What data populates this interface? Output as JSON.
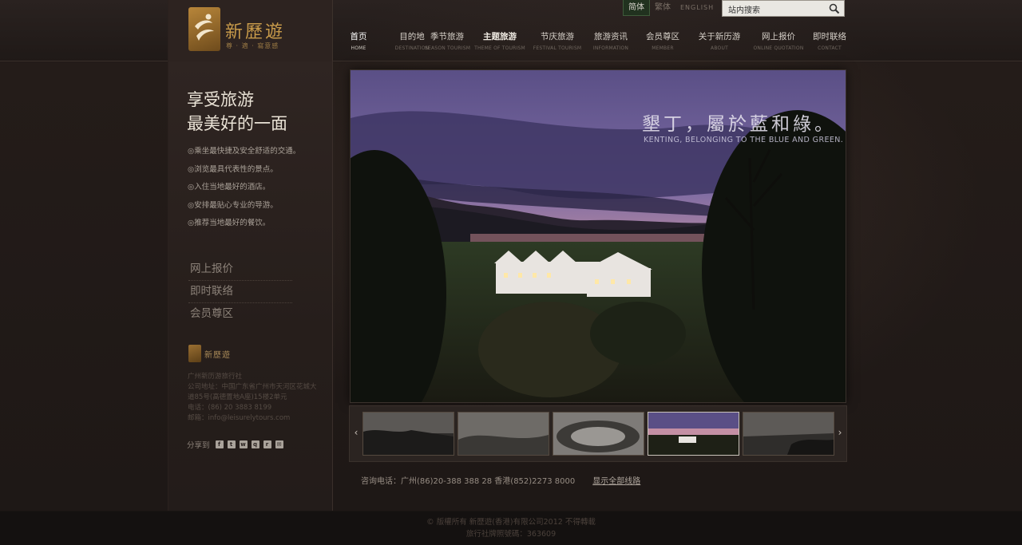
{
  "header": {
    "logo_name": "新歷遊",
    "logo_tagline": "尊 · 適 · 寫意感",
    "languages": [
      {
        "label": "简体",
        "active": true
      },
      {
        "label": "繁体",
        "active": false
      },
      {
        "label": "ENGLISH",
        "active": false
      }
    ],
    "search": {
      "placeholder": "站内搜索"
    },
    "nav": [
      {
        "cn": "首页",
        "en": "HOME"
      },
      {
        "cn": "目的地",
        "en": "DESTINATION"
      },
      {
        "cn": "季节旅游",
        "en": "SEASON TOURISM"
      },
      {
        "cn": "主题旅游",
        "en": "THEME OF TOURISM"
      },
      {
        "cn": "节庆旅游",
        "en": "FESTIVAL TOURISM"
      },
      {
        "cn": "旅游资讯",
        "en": "INFORMATION"
      },
      {
        "cn": "会员尊区",
        "en": "MEMBER"
      },
      {
        "cn": "关于新历游",
        "en": "ABOUT"
      },
      {
        "cn": "网上报价",
        "en": "ONLINE QUOTATION"
      },
      {
        "cn": "即时联络",
        "en": "CONTACT"
      }
    ]
  },
  "sidebar": {
    "slogan_line1": "享受旅游",
    "slogan_line2": "最美好的一面",
    "features": [
      "◎乘坐最快捷及安全舒适的交通。",
      "◎浏览最具代表性的景点。",
      "◎入住当地最好的酒店。",
      "◎安排最贴心专业的导游。",
      "◎推荐当地最好的餐饮。"
    ],
    "quick_links": [
      "网上报价",
      "即时联络",
      "会员尊区"
    ],
    "mini_logo": "新歷遊",
    "company": "广州新历游旅行社",
    "address": "公司地址：中国广东省广州市天河区花城大道85号(高德置地A座)15楼2单元",
    "phone": "电话：(86) 20 3883 8199",
    "email": "邮箱：info@leisurelytours.com",
    "share_label": "分享到"
  },
  "hero": {
    "title": "墾丁，屬於藍和綠。",
    "subtitle": "KENTING, BELONGING TO THE BLUE AND GREEN."
  },
  "thumbnails": {
    "count": 5,
    "active_index": 3
  },
  "footer": {
    "hotline": "咨询电话：广州(86)20-388 388 28  香港(852)2273 8000",
    "show_all": "显示全部线路",
    "copyright_line1": "© 版權所有 新歷遊(香港)有限公司2012 不得轉載",
    "copyright_line2": "旅行社牌照號碼：363609"
  },
  "colors": {
    "brand_gold": "#c79a4a",
    "lang_active_bg": "#21321f"
  }
}
